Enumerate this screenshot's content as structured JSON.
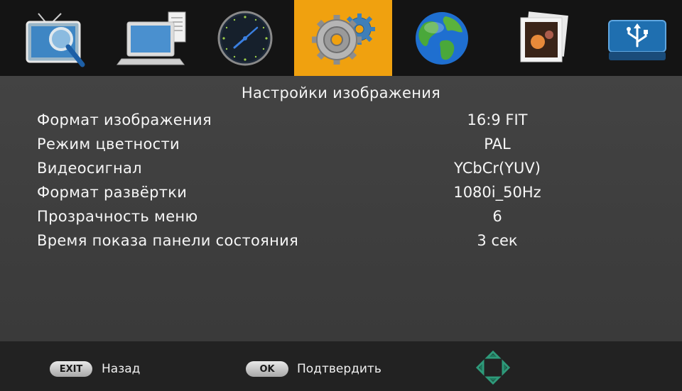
{
  "menu": {
    "tabs": [
      {
        "icon": "tv-search-icon",
        "active": false
      },
      {
        "icon": "laptop-icon",
        "active": false
      },
      {
        "icon": "clock-icon",
        "active": false
      },
      {
        "icon": "gears-icon",
        "active": true
      },
      {
        "icon": "globe-icon",
        "active": false
      },
      {
        "icon": "photo-icon",
        "active": false
      },
      {
        "icon": "usb-drive-icon",
        "active": false
      }
    ]
  },
  "panel": {
    "title": "Настройки изображения",
    "settings": [
      {
        "label": "Формат изображения",
        "value": "16:9 FIT"
      },
      {
        "label": "Режим цветности",
        "value": "PAL"
      },
      {
        "label": "Видеосигнал",
        "value": "YCbCr(YUV)"
      },
      {
        "label": "Формат развёртки",
        "value": "1080i_50Hz"
      },
      {
        "label": "Прозрачность меню",
        "value": "6"
      },
      {
        "label": "Время показа панели состояния",
        "value": "3 сек"
      }
    ]
  },
  "footer": {
    "exit_key": "EXIT",
    "exit_label": "Назад",
    "ok_key": "OK",
    "ok_label": "Подтвердить",
    "dpad_icon": "dpad-icon"
  },
  "colors": {
    "active_tab": "#f0a10f",
    "panel_bg": "#434343",
    "footer_bg": "#222222",
    "dpad": "#2e9a7a"
  }
}
